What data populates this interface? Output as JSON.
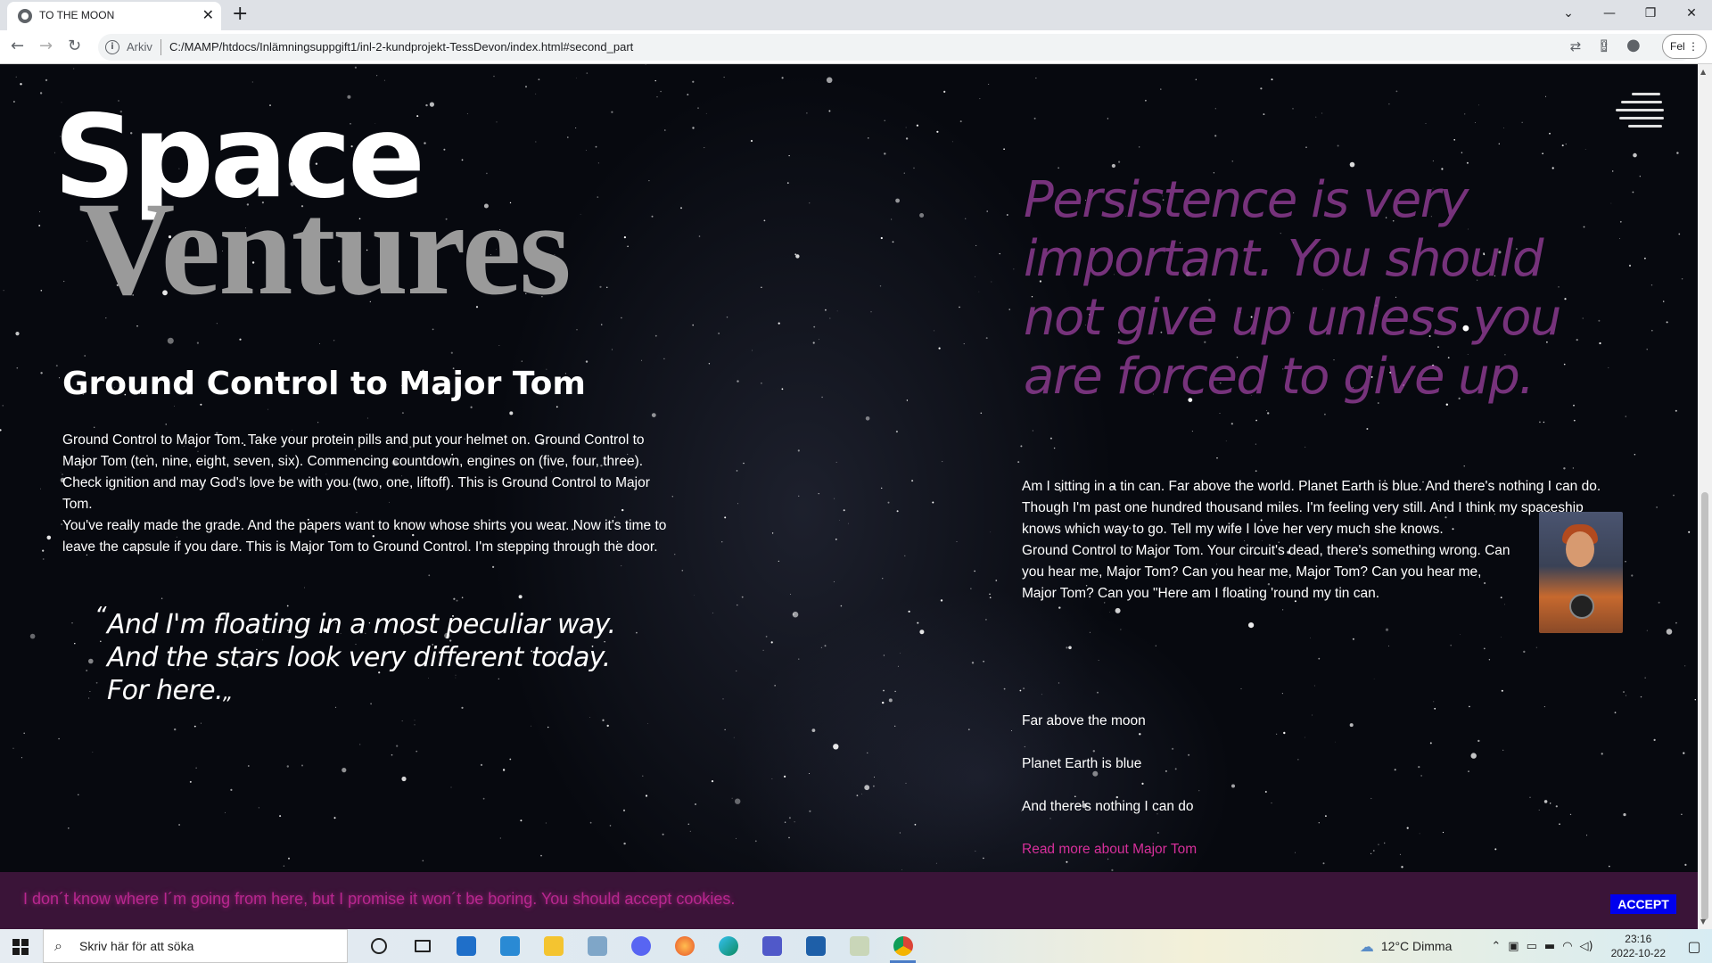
{
  "browser": {
    "tab_title": "TO THE MOON",
    "tab_close": "✕",
    "new_tab": "+",
    "arkiv": "Arkiv",
    "url": "C:/MAMP/htdocs/Inlämningsuppgift1/inl-2-kundprojekt-TessDevon/index.html#second_part",
    "profile_label": "Fel",
    "window_controls": [
      "⌄",
      "—",
      "❐",
      "✕"
    ]
  },
  "hero": {
    "logo_top": "Space",
    "logo_bottom": "Ventures"
  },
  "left": {
    "title": "Ground Control to Major Tom",
    "paragraph1": "Ground Control to Major Tom. Take your protein pills and put your helmet on. Ground Control to Major Tom (ten, nine, eight, seven, six). Commencing countdown, engines on (five, four, three). Check ignition and may God's love be with you (two, one, liftoff). This is Ground Control to Major Tom.",
    "paragraph2": "You've really made the grade. And the papers want to know whose shirts you wear. Now it's time to leave the capsule if you dare. This is Major Tom to Ground Control. I'm stepping through the door.",
    "quote_open": "“",
    "quote_lines": [
      "And I'm floating in a most peculiar way.",
      "And the stars look very different today.",
      "For here."
    ],
    "quote_close": "„"
  },
  "right": {
    "big_quote": "Persistence is very important. You should not give up unless you are forced to give up.",
    "paragraph1": "Am I sitting in a tin can. Far above the world. Planet Earth is blue. And there's nothing I can do. Though I'm past one hundred thousand miles. I'm feeling very still. And I think my spaceship knows which way to go. Tell my wife I love her very much she knows.",
    "paragraph2": "Ground Control to Major Tom. Your circuit's dead, there's something wrong. Can you hear me, Major Tom? Can you hear me, Major Tom? Can you hear me, Major Tom? Can you \"Here am I floating 'round my tin can.",
    "lines": [
      "Far above the moon",
      "Planet Earth is blue",
      "And there's nothing I can do"
    ],
    "read_more": "Read more about Major Tom"
  },
  "cookie": {
    "text": "I don´t know where I´m going from here, but I promise it won´t be boring. You should accept cookies.",
    "accept": "ACCEPT"
  },
  "taskbar": {
    "search_placeholder": "Skriv här för att söka",
    "weather": "12°C  Dimma",
    "time": "23:16",
    "date": "2022-10-22"
  },
  "colors": {
    "quote_purple": "#8a3a8e",
    "link_pink": "#d62f9a",
    "cookie_bg": "#3a1438",
    "accept_blue": "#0000ee"
  }
}
